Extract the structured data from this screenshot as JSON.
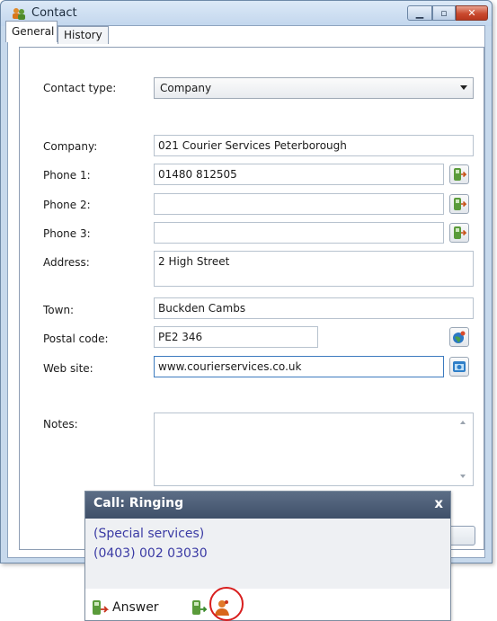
{
  "window": {
    "title": "Contact"
  },
  "tabs": [
    {
      "label": "General",
      "active": true
    },
    {
      "label": "History",
      "active": false
    }
  ],
  "form": {
    "contact_type": {
      "label": "Contact type:",
      "value": "Company"
    },
    "company": {
      "label": "Company:",
      "value": "021 Courier Services Peterborough"
    },
    "phone1": {
      "label": "Phone 1:",
      "value": "01480 812505"
    },
    "phone2": {
      "label": "Phone 2:",
      "value": ""
    },
    "phone3": {
      "label": "Phone 3:",
      "value": ""
    },
    "address": {
      "label": "Address:",
      "value": "2 High Street"
    },
    "town": {
      "label": "Town:",
      "value": "Buckden Cambs"
    },
    "postal_code": {
      "label": "Postal code:",
      "value": "PE2 346"
    },
    "website": {
      "label": "Web site:",
      "value": "www.courierservices.co.uk"
    },
    "notes": {
      "label": "Notes:",
      "value": ""
    }
  },
  "call_popup": {
    "title": "Call: Ringing",
    "close_glyph": "x",
    "caller_name": "(Special services)",
    "caller_number": "(0403) 002 03030",
    "answer_label": "Answer"
  },
  "icons": {
    "app": "contact-app-icon",
    "dial": "phone-dial-icon",
    "map": "globe-map-icon",
    "browser": "web-browser-icon",
    "answer": "answer-call-icon",
    "forward": "forward-call-icon",
    "person": "contact-person-icon"
  },
  "colors": {
    "caller_text": "#3a3aa4",
    "popup_header": "#4a5b73",
    "highlight": "#d81e1e",
    "close_button": "#c94a2e"
  }
}
